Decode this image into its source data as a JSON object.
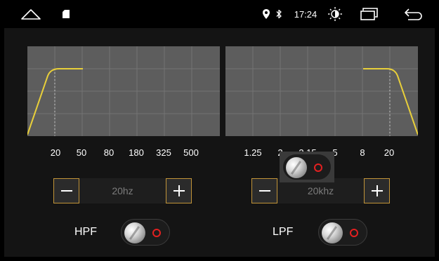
{
  "status_bar": {
    "icons": [
      "home-icon",
      "sd-card-icon",
      "location-icon",
      "bluetooth-icon",
      "brightness-icon",
      "recent-apps-icon",
      "back-icon"
    ],
    "time": "17:24"
  },
  "hpf": {
    "label": "HPF",
    "ticks": [
      "20",
      "50",
      "80",
      "180",
      "325",
      "500"
    ],
    "value": "20hz",
    "switch_on": false
  },
  "lpf": {
    "label": "LPF",
    "ticks": [
      "1.25",
      "2",
      "3.15",
      "5",
      "8",
      "20"
    ],
    "value": "20khz",
    "switch_on": false
  },
  "colors": {
    "curve": "#e8cf3a",
    "button_border": "#c29438",
    "switch_dot": "#e32020",
    "graph_bg": "#5d5d5d"
  }
}
